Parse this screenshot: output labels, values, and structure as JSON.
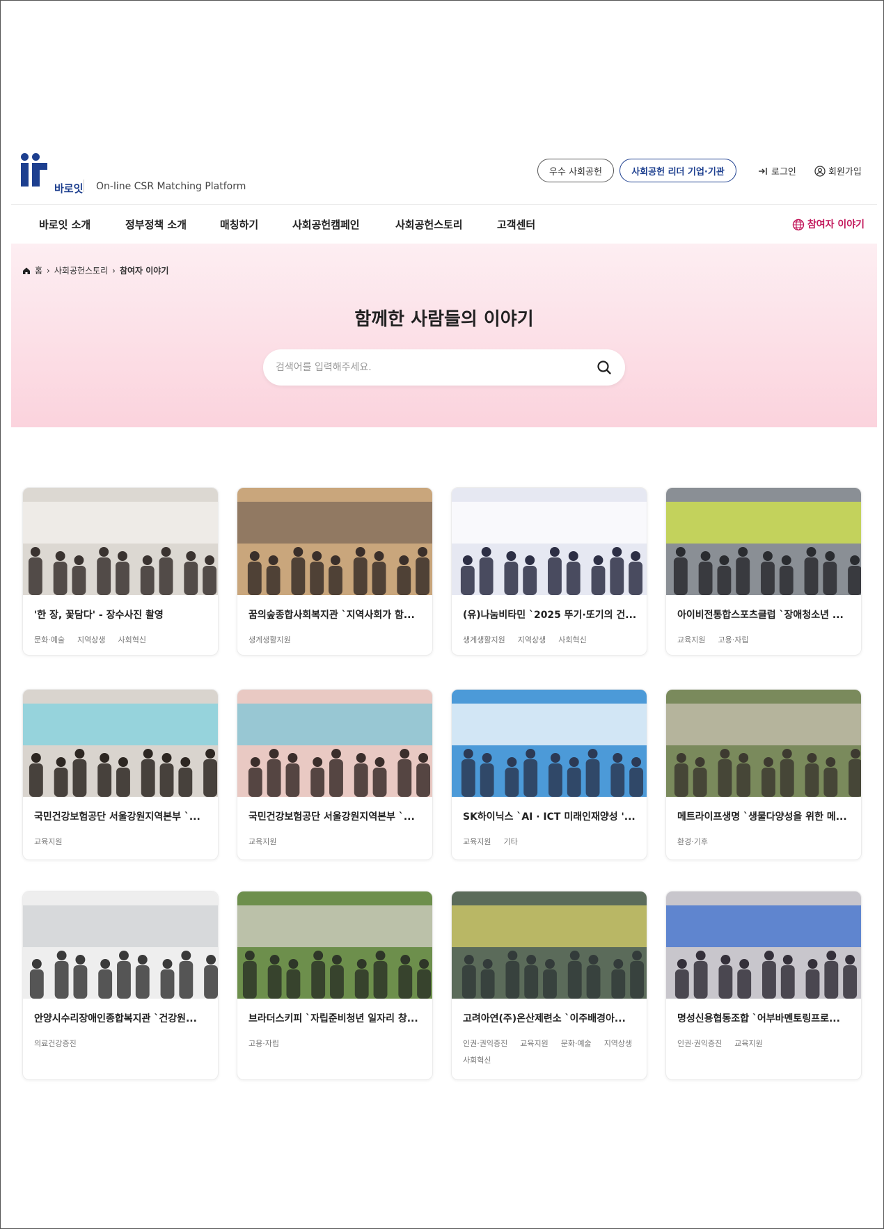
{
  "header": {
    "logo_text": "바로잇",
    "tagline": "On-line CSR Matching Platform",
    "pill_excellent": "우수 사회공헌",
    "pill_leader": "사회공헌 리더 기업·기관",
    "login": "로그인",
    "join": "회원가입"
  },
  "nav": {
    "items": [
      "바로잇 소개",
      "정부정책 소개",
      "매칭하기",
      "사회공헌캠페인",
      "사회공헌스토리",
      "고객센터"
    ],
    "right": "참여자 이야기"
  },
  "hero": {
    "breadcrumb": [
      "홈",
      "사회공헌스토리",
      "참여자 이야기"
    ],
    "title": "함께한 사람들의 이야기",
    "search_placeholder": "검색어를 입력해주세요."
  },
  "cards": [
    {
      "title": "'한 장, 꽃담다' - 장수사진 촬영",
      "tags": [
        "문화·예술",
        "지역상생",
        "사회혁신"
      ],
      "palette": [
        "#dcd8d2",
        "#f4f2ee",
        "#3a3330"
      ]
    },
    {
      "title": "꿈의숲종합사회복지관 `지역사회가 함...",
      "tags": [
        "생계생활지원"
      ],
      "palette": [
        "#c9a67c",
        "#7d6a5a",
        "#3a2f2a"
      ]
    },
    {
      "title": "(유)나눔비타민 `2025 뚜기·또기의 건...",
      "tags": [
        "생계생활지원",
        "지역상생",
        "사회혁신"
      ],
      "palette": [
        "#e6e8f2",
        "#ffffff",
        "#2d2f45"
      ]
    },
    {
      "title": "아이비전통합스포츠클럽 `장애청소년 ...",
      "tags": [
        "교육지원",
        "고용·자립"
      ],
      "palette": [
        "#8a8f95",
        "#d6e84a",
        "#2a2c30"
      ]
    },
    {
      "title": "국민건강보험공단 서울강원지역본부 `...",
      "tags": [
        "교육지원"
      ],
      "palette": [
        "#d9d4ce",
        "#7fd3e0",
        "#2d2722"
      ]
    },
    {
      "title": "국민건강보험공단 서울강원지역본부 `...",
      "tags": [
        "교육지원"
      ],
      "palette": [
        "#e9c9c3",
        "#7cc6d8",
        "#3b2e2b"
      ]
    },
    {
      "title": "SK하이닉스 `AI · ICT 미래인재양성 '...",
      "tags": [
        "교육지원",
        "기타"
      ],
      "palette": [
        "#4c9ad8",
        "#ffffff",
        "#2c3a55"
      ]
    },
    {
      "title": "메트라이프생명 `생물다양성을 위한 메...",
      "tags": [
        "환경·기후"
      ],
      "palette": [
        "#7a8a5c",
        "#c9c1b1",
        "#3d3a30"
      ]
    },
    {
      "title": "안양시수리장애인종합복지관 `건강원...",
      "tags": [
        "의료건강증진"
      ],
      "palette": [
        "#eeeeee",
        "#cfd2d4",
        "#3a3a3a"
      ]
    },
    {
      "title": "브라더스키피 `자립준비청년 일자리 창...",
      "tags": [
        "고용·자립"
      ],
      "palette": [
        "#6d8f4c",
        "#d6d2c8",
        "#2e3628"
      ]
    },
    {
      "title": "고려아연(주)온산제련소 `이주배경아...",
      "tags": [
        "인권·권익증진",
        "교육지원",
        "문화·예술",
        "지역상생",
        "사회혁신"
      ],
      "palette": [
        "#5b6b5a",
        "#d8d06a",
        "#333b3a"
      ]
    },
    {
      "title": "명성신용협동조합 `어부바멘토링프로...",
      "tags": [
        "인권·권익증진",
        "교육지원"
      ],
      "palette": [
        "#c8c6cc",
        "#3c6fd0",
        "#34303a"
      ]
    }
  ]
}
